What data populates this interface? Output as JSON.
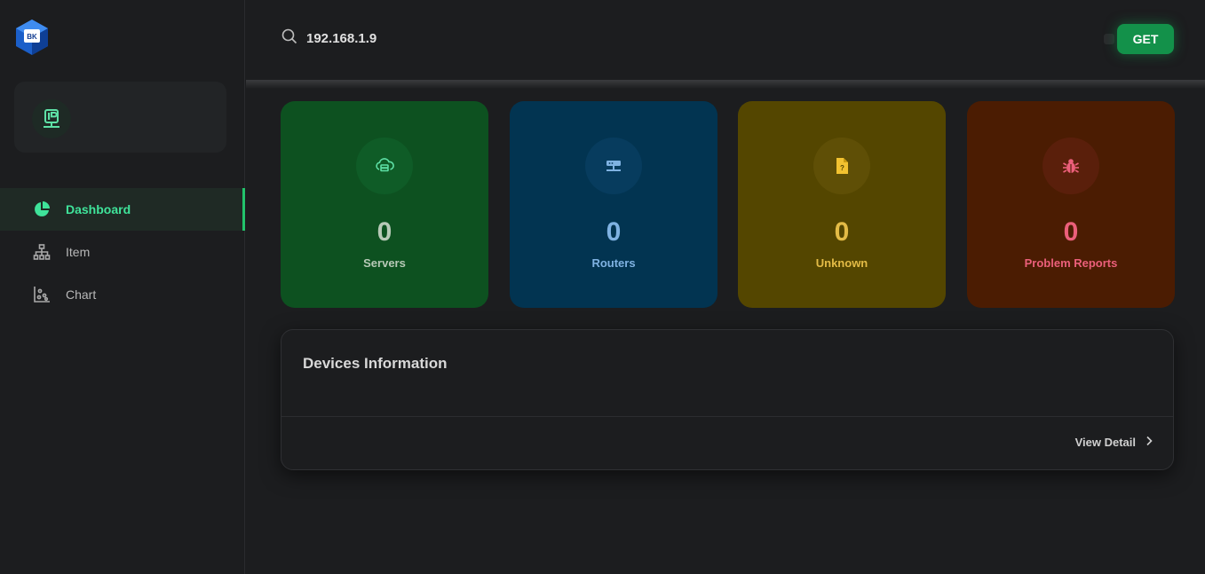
{
  "app": {
    "logo_text": "BK"
  },
  "search": {
    "value": "192.168.1.9",
    "placeholder": ""
  },
  "toolbar": {
    "get_label": "GET"
  },
  "sidebar": {
    "items": [
      {
        "label": "Dashboard",
        "icon": "pie-chart-icon",
        "active": true
      },
      {
        "label": "Item",
        "icon": "hierarchy-icon",
        "active": false
      },
      {
        "label": "Chart",
        "icon": "scatter-chart-icon",
        "active": false
      }
    ]
  },
  "stats": [
    {
      "value": "0",
      "label": "Servers",
      "icon": "server-cloud-icon",
      "bg": "#0d5120",
      "color": "#b7c9b7"
    },
    {
      "value": "0",
      "label": "Routers",
      "icon": "router-icon",
      "bg": "#023451",
      "color": "#7fb2e2"
    },
    {
      "value": "0",
      "label": "Unknown",
      "icon": "unknown-file-icon",
      "bg": "#544600",
      "color": "#e3bb46"
    },
    {
      "value": "0",
      "label": "Problem Reports",
      "icon": "bug-icon",
      "bg": "#4b1c02",
      "color": "#eb5f7a"
    }
  ],
  "devices": {
    "title": "Devices Information",
    "view_detail": "View Detail"
  },
  "colors": {
    "accent": "#13914a",
    "active_text": "#3fe39a"
  }
}
